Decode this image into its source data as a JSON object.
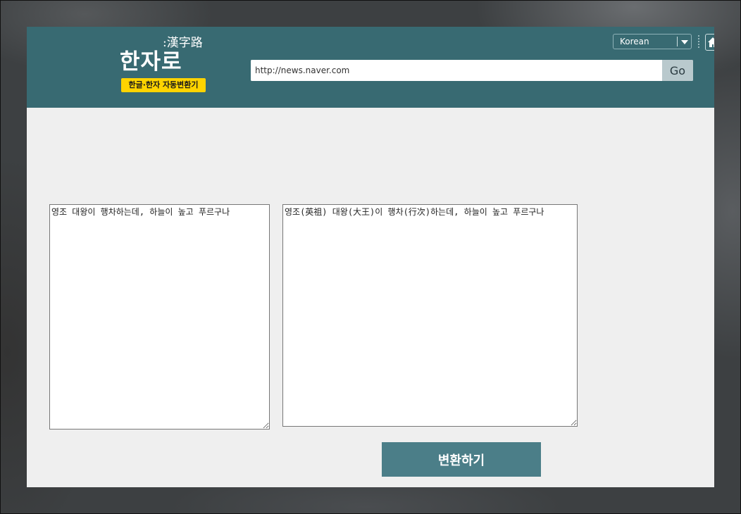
{
  "header": {
    "logo_text": "한자로",
    "logo_hanja": ":漢字路",
    "logo_badge": "한글·한자 자동변환기",
    "language": {
      "selected": "Korean",
      "icon": "chevron-down-icon"
    },
    "home_icon": "home-icon",
    "url_bar": {
      "value": "http://news.naver.com",
      "go_label": "Go"
    }
  },
  "converter": {
    "input_text": "영조 대왕이 행차하는데, 하늘이 높고 푸르구나",
    "output_text": "영조(英祖) 대왕(大王)이 행차(行次)하는데, 하늘이 높고 푸르구나",
    "convert_label": "변환하기"
  },
  "colors": {
    "header_bg": "#386a72",
    "badge_bg": "#ffd400",
    "button_bg": "#4b7e88",
    "content_bg": "#efefef"
  }
}
